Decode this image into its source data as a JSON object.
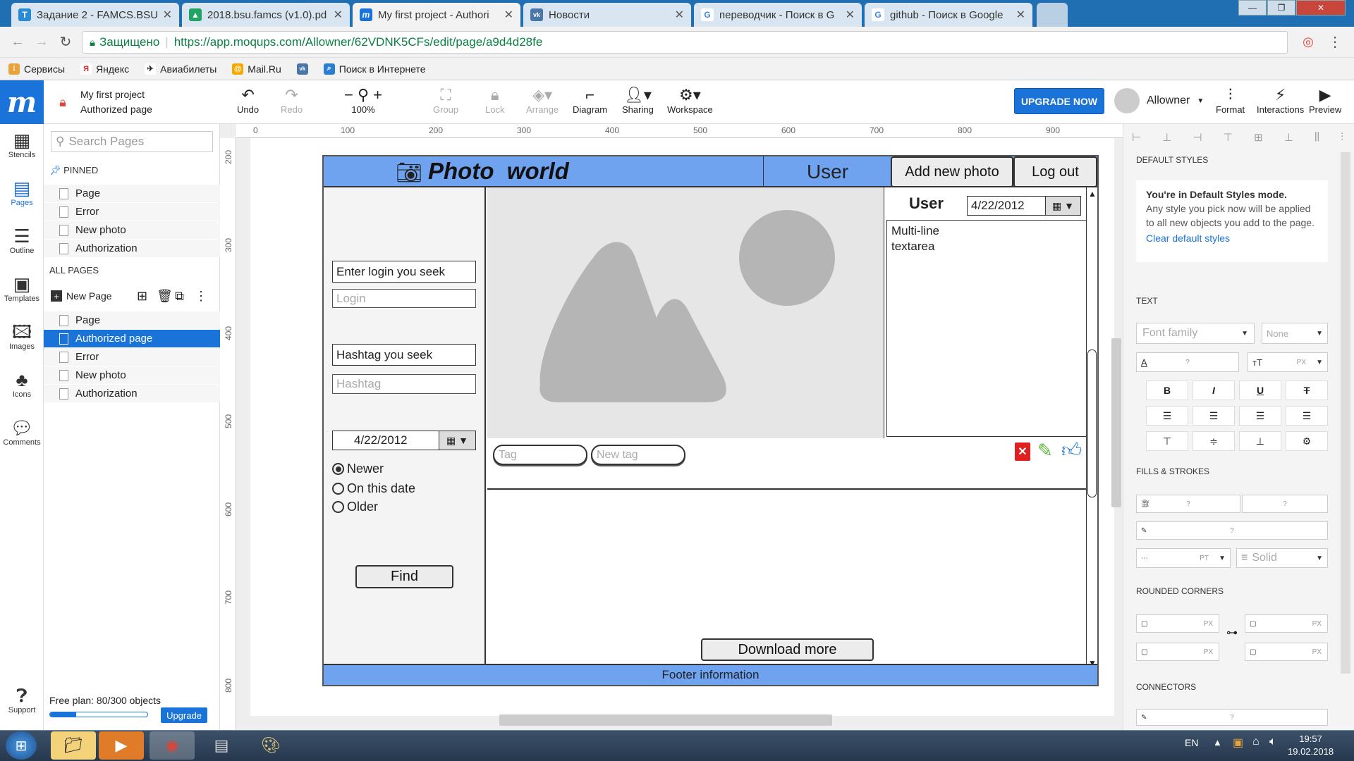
{
  "browser": {
    "tabs": [
      {
        "title": "Задание 2 - FAMCS.BSU",
        "icon_color": "#2a8ad4",
        "icon": "T"
      },
      {
        "title": "2018.bsu.famcs (v1.0).pd",
        "icon_color": "#1fa463",
        "icon": "▲"
      },
      {
        "title": "My first project - Authori",
        "icon_color": "#1a73d9",
        "icon": "m"
      },
      {
        "title": "Новости",
        "icon_color": "#4a76a8",
        "icon": "vk"
      },
      {
        "title": "переводчик - Поиск в G",
        "icon_color": "#ffffff",
        "icon": "G"
      },
      {
        "title": "github - Поиск в Google",
        "icon_color": "#ffffff",
        "icon": "G"
      }
    ],
    "secure_label": "Защищено",
    "url": "https://app.moqups.com/Allowner/62VDNK5CFs/edit/page/a9d4d28fe",
    "bookmarks": [
      {
        "label": "Сервисы",
        "icon": "apps-icon"
      },
      {
        "label": "Яндекс",
        "icon": "yandex-icon"
      },
      {
        "label": "Авиабилеты",
        "icon": "plane-icon"
      },
      {
        "label": "Mail.Ru",
        "icon": "mailru-icon"
      },
      {
        "label": "",
        "icon": "vk-icon"
      },
      {
        "label": "Поиск в Интернете",
        "icon": "search-icon"
      }
    ]
  },
  "app": {
    "project_name": "My first project",
    "page_name": "Authorized page",
    "toolbar": {
      "undo": "Undo",
      "redo": "Redo",
      "zoom": "100%",
      "group": "Group",
      "lock": "Lock",
      "arrange": "Arrange",
      "diagram": "Diagram",
      "sharing": "Sharing",
      "workspace": "Workspace",
      "upgrade": "UPGRADE NOW",
      "user": "Allowner",
      "format": "Format",
      "interactions": "Interactions",
      "preview": "Preview"
    },
    "rail": [
      "Stencils",
      "Pages",
      "Outline",
      "Templates",
      "Images",
      "Icons",
      "Comments",
      "Support"
    ],
    "pages_panel": {
      "search_placeholder": "Search Pages",
      "pinned_label": "PINNED",
      "pinned": [
        "Page",
        "Error",
        "New photo",
        "Authorization"
      ],
      "all_label": "ALL PAGES",
      "new_page": "New Page",
      "all": [
        "Page",
        "Authorized page",
        "Error",
        "New photo",
        "Authorization"
      ],
      "selected_index": 1,
      "plan": "Free plan: 80/300 objects",
      "plan_progress": 0.27,
      "upgrade": "Upgrade"
    },
    "ruler": {
      "h": [
        "0",
        "100",
        "200",
        "300",
        "400",
        "500",
        "600",
        "700",
        "800",
        "900"
      ],
      "v": [
        "200",
        "300",
        "400",
        "500",
        "600",
        "700",
        "800"
      ]
    }
  },
  "mockup": {
    "title": "Photo  world",
    "user_header": "User",
    "add_photo": "Add new photo",
    "logout": "Log out",
    "login_label": "Enter login you seek",
    "login_placeholder": "Login",
    "hashtag_label": "Hashtag you seek",
    "hashtag_placeholder": "Hashtag",
    "date": "4/22/2012",
    "radios": [
      {
        "label": "Newer",
        "checked": true
      },
      {
        "label": "On this date",
        "checked": false
      },
      {
        "label": "Older",
        "checked": false
      }
    ],
    "find": "Find",
    "side_user": "User",
    "side_date": "4/22/2012",
    "textarea": "Multi-line\ntextarea",
    "tag_placeholder": "Tag",
    "newtag_placeholder": "New tag",
    "download_more": "Download more",
    "footer": "Footer information"
  },
  "right_panel": {
    "default_styles": "DEFAULT STYLES",
    "default_title": "You're in Default Styles mode.",
    "default_body": "Any style you pick now will be applied to all new objects you add to the page.",
    "clear_link": "Clear default styles",
    "text": "TEXT",
    "font_family": "Font family",
    "none": "None",
    "q": "?",
    "px": "PX",
    "pt": "PT",
    "fills": "FILLS & STROKES",
    "solid": "Solid",
    "rounded": "ROUNDED CORNERS",
    "connectors": "CONNECTORS"
  },
  "taskbar": {
    "lang": "EN",
    "time": "19:57",
    "date": "19.02.2018"
  }
}
